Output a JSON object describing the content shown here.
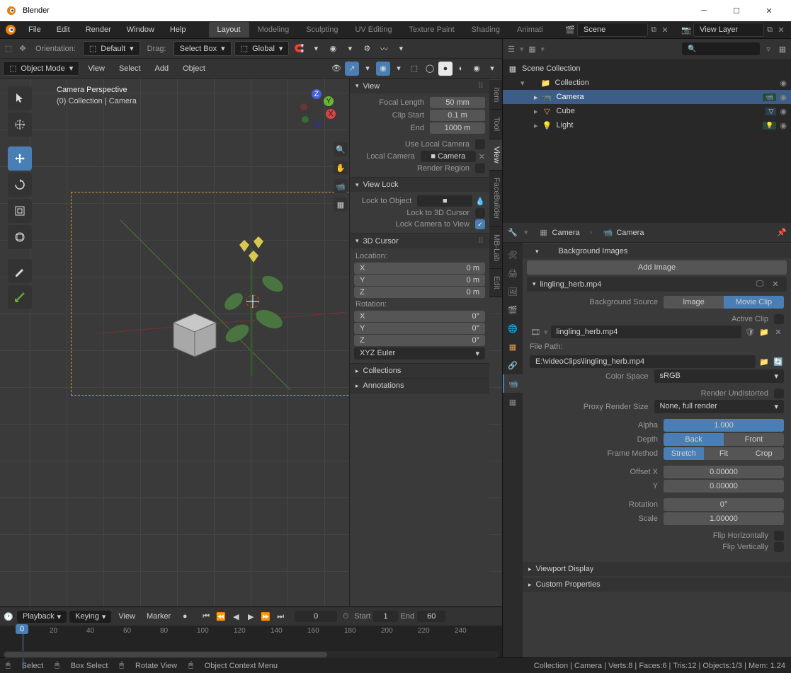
{
  "title": "Blender",
  "menu": [
    "File",
    "Edit",
    "Render",
    "Window",
    "Help"
  ],
  "workspaces": [
    "Layout",
    "Modeling",
    "Sculpting",
    "UV Editing",
    "Texture Paint",
    "Shading",
    "Animati"
  ],
  "active_workspace": "Layout",
  "scene_label": "Scene",
  "viewlayer_label": "View Layer",
  "header": {
    "orientation_lbl": "Orientation:",
    "orientation_val": "Default",
    "drag_lbl": "Drag:",
    "drag_val": "Select Box",
    "transform_val": "Global"
  },
  "mode": "Object Mode",
  "view_menus": [
    "View",
    "Select",
    "Add",
    "Object"
  ],
  "viewport_info": {
    "l1": "Camera Perspective",
    "l2": "(0) Collection | Camera"
  },
  "n_tabs": [
    "Item",
    "Tool",
    "View",
    "FaceBuilder",
    "MB-Lab",
    "Edit"
  ],
  "n_active": "View",
  "panel_view": {
    "title": "View",
    "focal_lbl": "Focal Length",
    "focal_val": "50 mm",
    "clipstart_lbl": "Clip Start",
    "clipstart_val": "0.1 m",
    "end_lbl": "End",
    "end_val": "1000 m",
    "localcam_chk": "Use Local Camera",
    "localcam_lbl": "Local Camera",
    "localcam_val": "Camera",
    "render_region": "Render Region"
  },
  "panel_viewlock": {
    "title": "View Lock",
    "lock_obj": "Lock to Object",
    "lock_cursor": "Lock to 3D Cursor",
    "lock_cam": "Lock Camera to View"
  },
  "panel_cursor": {
    "title": "3D Cursor",
    "loc": "Location:",
    "rot": "Rotation:",
    "x": "X",
    "y": "Y",
    "z": "Z",
    "loc_x": "0 m",
    "loc_y": "0 m",
    "loc_z": "0 m",
    "rot_x": "0°",
    "rot_y": "0°",
    "rot_z": "0°",
    "mode": "XYZ Euler"
  },
  "panel_collections": "Collections",
  "panel_annotations": "Annotations",
  "outliner": {
    "root": "Scene Collection",
    "collection": "Collection",
    "items": [
      {
        "name": "Camera",
        "selected": true
      },
      {
        "name": "Cube",
        "selected": false
      },
      {
        "name": "Light",
        "selected": false
      }
    ]
  },
  "props_breadcrumb": [
    "Camera",
    "Camera"
  ],
  "bg_images": {
    "title": "Background Images",
    "add": "Add Image",
    "item": "lingling_herb.mp4",
    "source_lbl": "Background Source",
    "source_opts": [
      "Image",
      "Movie Clip"
    ],
    "active_clip": "Active Clip",
    "clip_name": "lingling_herb.mp4",
    "filepath_lbl": "File Path:",
    "filepath": "E:\\videoClips\\lingling_herb.mp4",
    "colorspace_lbl": "Color Space",
    "colorspace": "sRGB",
    "undistorted": "Render Undistorted",
    "proxy_lbl": "Proxy Render Size",
    "proxy": "None, full render",
    "alpha_lbl": "Alpha",
    "alpha": "1.000",
    "depth_lbl": "Depth",
    "depth_opts": [
      "Back",
      "Front"
    ],
    "frame_lbl": "Frame Method",
    "frame_opts": [
      "Stretch",
      "Fit",
      "Crop"
    ],
    "offx_lbl": "Offset X",
    "offx": "0.00000",
    "offy_lbl": "Y",
    "offy": "0.00000",
    "rot_lbl": "Rotation",
    "rot": "0°",
    "scale_lbl": "Scale",
    "scale": "1.00000",
    "fliph": "Flip Horizontally",
    "flipv": "Flip Vertically"
  },
  "viewport_display": "Viewport Display",
  "custom_props": "Custom Properties",
  "timeline": {
    "playback": "Playback",
    "keying": "Keying",
    "view": "View",
    "marker": "Marker",
    "cur": "0",
    "start_lbl": "Start",
    "start": "1",
    "end_lbl": "End",
    "end": "60",
    "ticks": [
      "0",
      "20",
      "40",
      "60",
      "80",
      "100",
      "120",
      "140",
      "160",
      "180",
      "200",
      "220",
      "240"
    ]
  },
  "status": {
    "left": [
      "Select",
      "Box Select",
      "Rotate View",
      "Object Context Menu"
    ],
    "right": "Collection | Camera | Verts:8 | Faces:6 | Tris:12 | Objects:1/3 | Mem: 1.24"
  }
}
